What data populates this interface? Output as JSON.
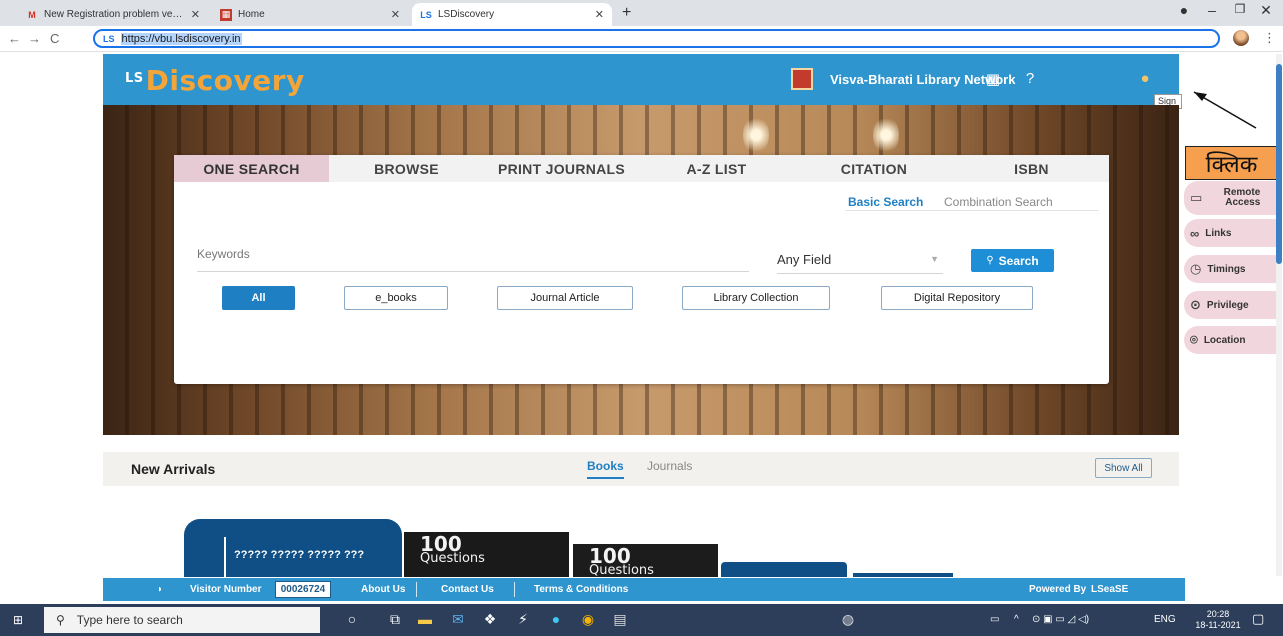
{
  "browser": {
    "tabs": [
      {
        "title": "New Registration problem very u",
        "favicon": "gmail-icon",
        "active": false
      },
      {
        "title": "Home",
        "favicon": "home-site-icon",
        "active": false
      },
      {
        "title": "LSDiscovery",
        "favicon": "ls-icon",
        "active": true
      }
    ],
    "new_tab_label": "+",
    "url_prefix": "LS",
    "url": "https://vbu.lsdiscovery.in"
  },
  "header": {
    "logo_prefix": "LS",
    "logo_text": "Discovery",
    "institution": "Visva-Bharati Library Network",
    "signin_tooltip": "Sign In"
  },
  "search": {
    "tabs": [
      "ONE SEARCH",
      "BROWSE",
      "PRINT JOURNALS",
      "A-Z LIST",
      "CITATION",
      "ISBN"
    ],
    "active_tab": "ONE SEARCH",
    "subtabs": [
      "Basic Search",
      "Combination Search"
    ],
    "keyword_placeholder": "Keywords",
    "field_select": "Any Field",
    "search_button": "Search",
    "filters": [
      "All",
      "e_books",
      "Journal Article",
      "Library Collection",
      "Digital Repository"
    ]
  },
  "annotation": {
    "hindi_label": "क्लिक"
  },
  "side_widgets": [
    {
      "label": "Remote Access",
      "icon": "monitor-icon"
    },
    {
      "label": "Links",
      "icon": "link-icon"
    },
    {
      "label": "Timings",
      "icon": "clock-icon"
    },
    {
      "label": "Privilege",
      "icon": "privilege-icon"
    },
    {
      "label": "Location",
      "icon": "location-icon"
    }
  ],
  "arrivals": {
    "title": "New Arrivals",
    "tabs": [
      "Books",
      "Journals"
    ],
    "show_all": "Show All",
    "books": [
      {
        "title": "????? ????? ????? ???"
      },
      {
        "title": "100",
        "subtitle": "Questions"
      },
      {
        "title": "100",
        "subtitle": "Questions"
      }
    ]
  },
  "footer": {
    "visitor_label": "Visitor Number",
    "visitor_number": "00026724",
    "about": "About Us",
    "contact": "Contact Us",
    "terms": "Terms & Conditions",
    "powered": "Powered By",
    "powered_brand": "LSeaSE"
  },
  "taskbar": {
    "search_placeholder": "Type here to search",
    "lang": "ENG",
    "time": "20:28",
    "date": "18-11-2021"
  },
  "colors": {
    "header_blue": "#2e95cf",
    "logo_orange": "#f3a53a",
    "active_tab_pink": "#e6cbd4",
    "accent_blue": "#1e7fc2",
    "annotation_orange": "#f6a04f"
  }
}
